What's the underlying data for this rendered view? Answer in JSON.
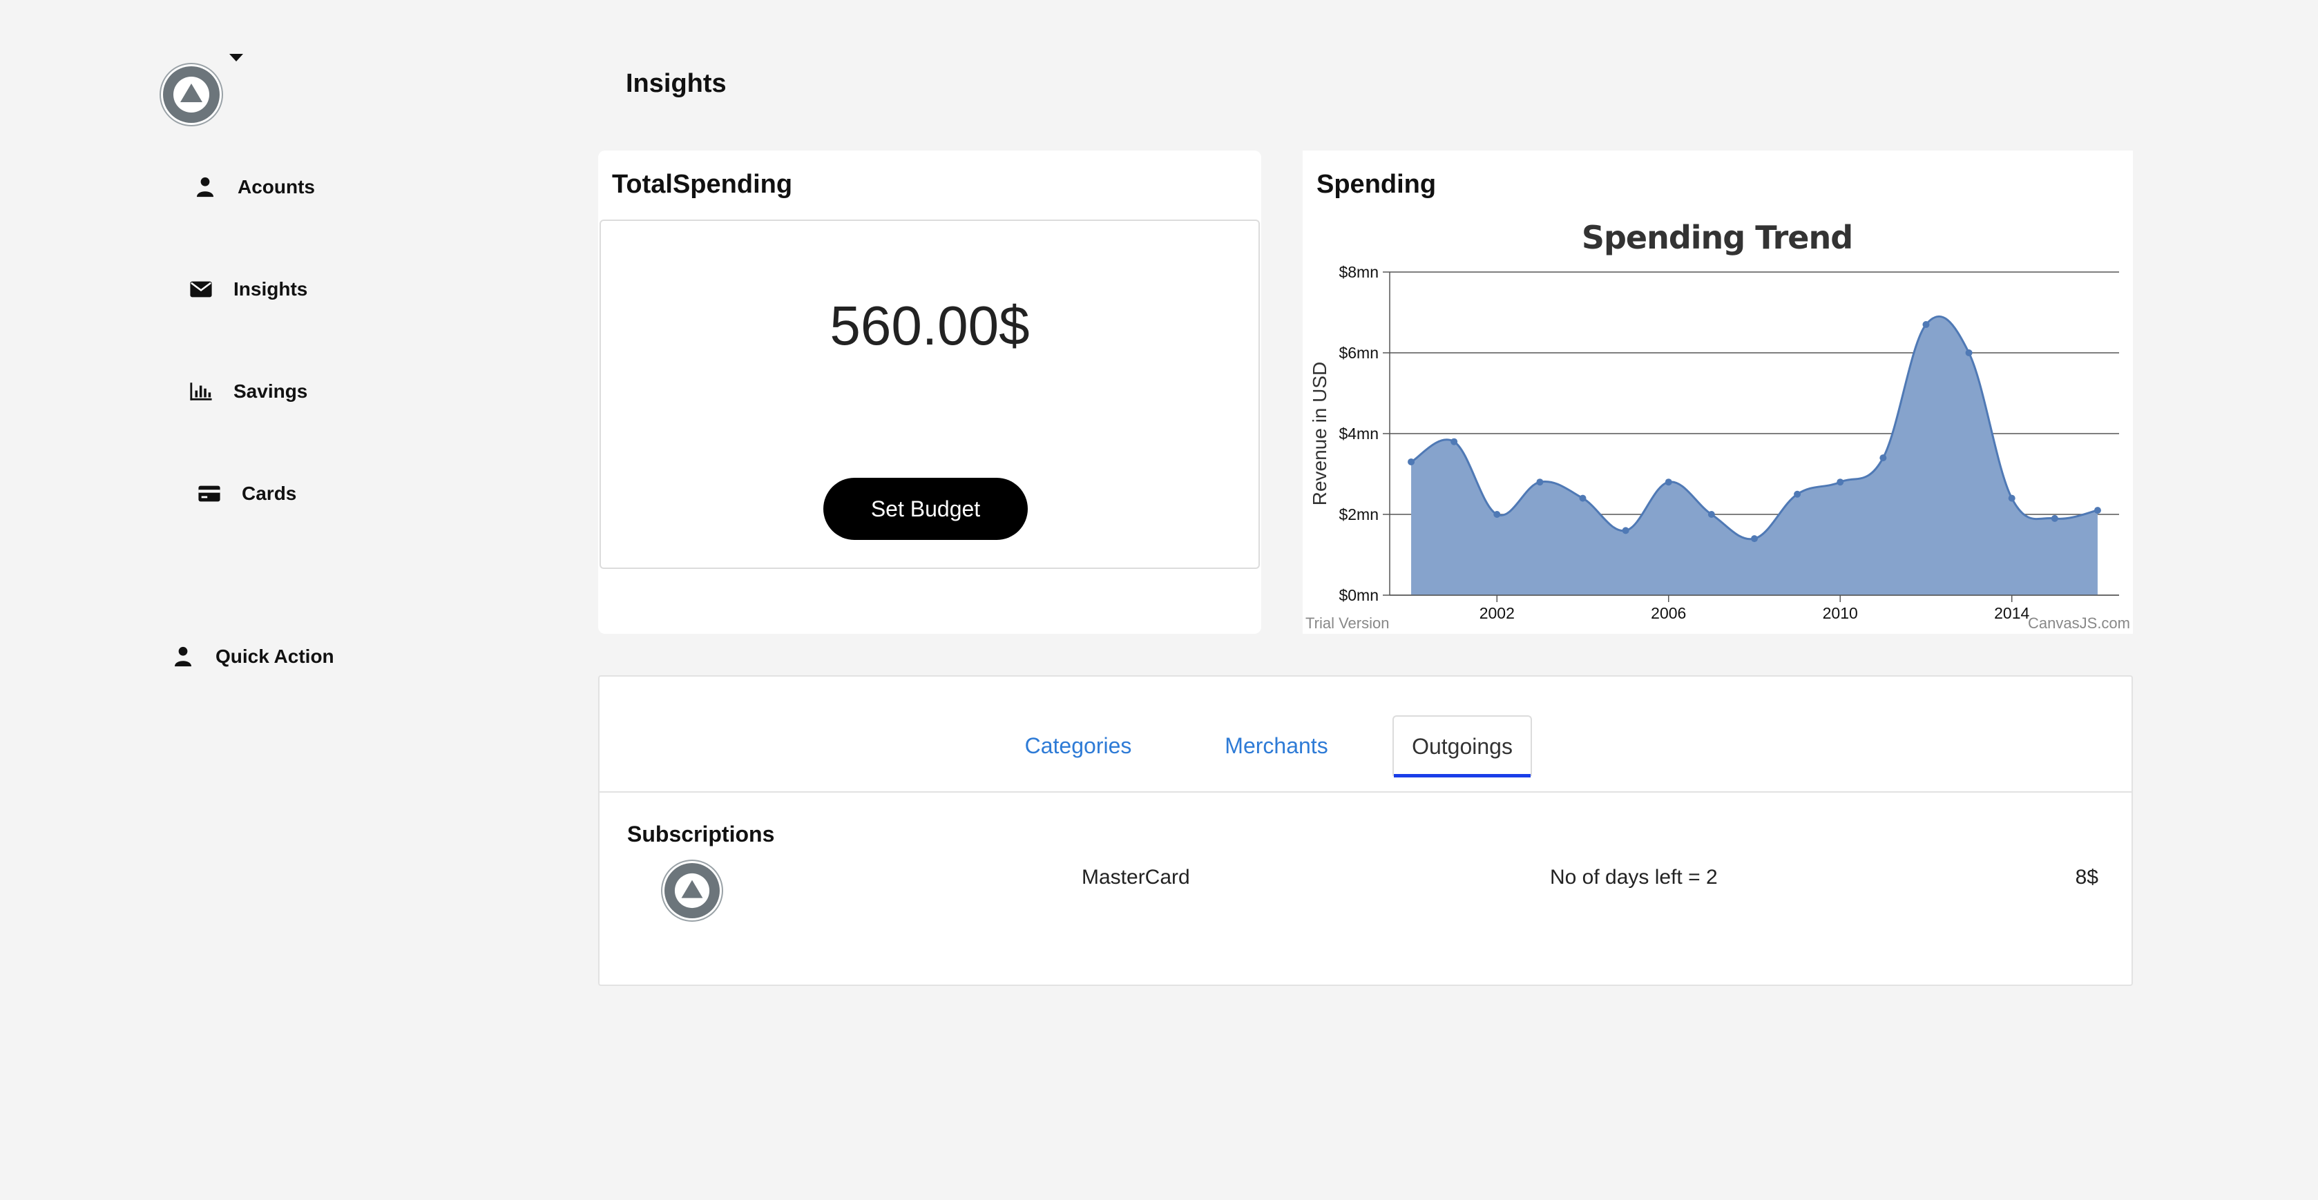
{
  "sidebar": {
    "items": [
      {
        "label": "Acounts",
        "icon": "user-icon"
      },
      {
        "label": "Insights",
        "icon": "envelope-icon"
      },
      {
        "label": "Savings",
        "icon": "bar-chart-icon"
      },
      {
        "label": "Cards",
        "icon": "credit-card-icon"
      }
    ],
    "quick_action": {
      "label": "Quick Action",
      "icon": "user-icon"
    }
  },
  "header": {
    "title": "Insights"
  },
  "total_spending": {
    "title": "TotalSpending",
    "amount": "560.00$",
    "button_label": "Set Budget"
  },
  "spending_chart": {
    "card_title": "Spending",
    "watermark_left": "Trial Version",
    "watermark_right": "CanvasJS.com",
    "fill_color": "#86a3cc",
    "line_color": "#4f79b5"
  },
  "chart_data": {
    "type": "area",
    "title": "Spending Trend",
    "ylabel": "Revenue in USD",
    "xlabel": "",
    "x": [
      2000,
      2001,
      2002,
      2003,
      2004,
      2005,
      2006,
      2007,
      2008,
      2009,
      2010,
      2011,
      2012,
      2013,
      2014,
      2015,
      2016
    ],
    "values": [
      3.3,
      3.8,
      2.0,
      2.8,
      2.4,
      1.6,
      2.8,
      2.0,
      1.4,
      2.5,
      2.8,
      3.4,
      6.7,
      6.0,
      2.4,
      1.9,
      2.1
    ],
    "xticks": [
      "2002",
      "2006",
      "2010",
      "2014"
    ],
    "xtick_values": [
      2002,
      2006,
      2010,
      2014
    ],
    "yticks": [
      "$0mn",
      "$2mn",
      "$4mn",
      "$6mn",
      "$8mn"
    ],
    "ytick_values": [
      0,
      2,
      4,
      6,
      8
    ],
    "ylim": [
      0,
      8
    ],
    "grid": true
  },
  "tabs": [
    {
      "label": "Categories",
      "active": false
    },
    {
      "label": "Merchants",
      "active": false
    },
    {
      "label": "Outgoings",
      "active": true
    }
  ],
  "subscriptions": {
    "title": "Subscriptions",
    "rows": [
      {
        "name": "MasterCard",
        "days_left": "No of days left = 2",
        "amount": "8$"
      }
    ]
  }
}
